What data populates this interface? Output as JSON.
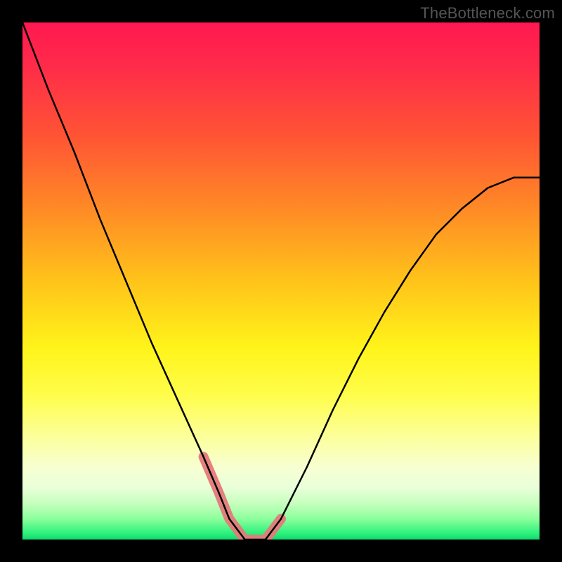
{
  "watermark": "TheBottleneck.com",
  "chart_data": {
    "type": "line",
    "title": "",
    "xlabel": "",
    "ylabel": "",
    "x_range": [
      0,
      100
    ],
    "y_range": [
      0,
      100
    ],
    "background_gradient": {
      "top": "#ff1850",
      "bottom": "#15d66d",
      "description": "vertical rainbow gradient red→orange→yellow→green"
    },
    "series": [
      {
        "name": "curve",
        "x": [
          0,
          5,
          10,
          15,
          20,
          25,
          30,
          35,
          38,
          40,
          43,
          47,
          50,
          55,
          60,
          65,
          70,
          75,
          80,
          85,
          90,
          95,
          100
        ],
        "values": [
          100,
          87,
          75,
          62,
          50,
          38,
          27,
          16,
          9,
          4,
          0,
          0,
          4,
          14,
          25,
          35,
          44,
          52,
          59,
          64,
          68,
          70,
          70
        ]
      },
      {
        "name": "highlight-segment",
        "x": [
          35,
          38,
          40,
          43,
          47,
          50
        ],
        "values": [
          16,
          9,
          4,
          0,
          0,
          4
        ]
      }
    ],
    "notes": "No explicit axes, tick labels, or numeric annotations are visible; values are estimated from pixel positions. Plot region is inset with a black border frame."
  }
}
